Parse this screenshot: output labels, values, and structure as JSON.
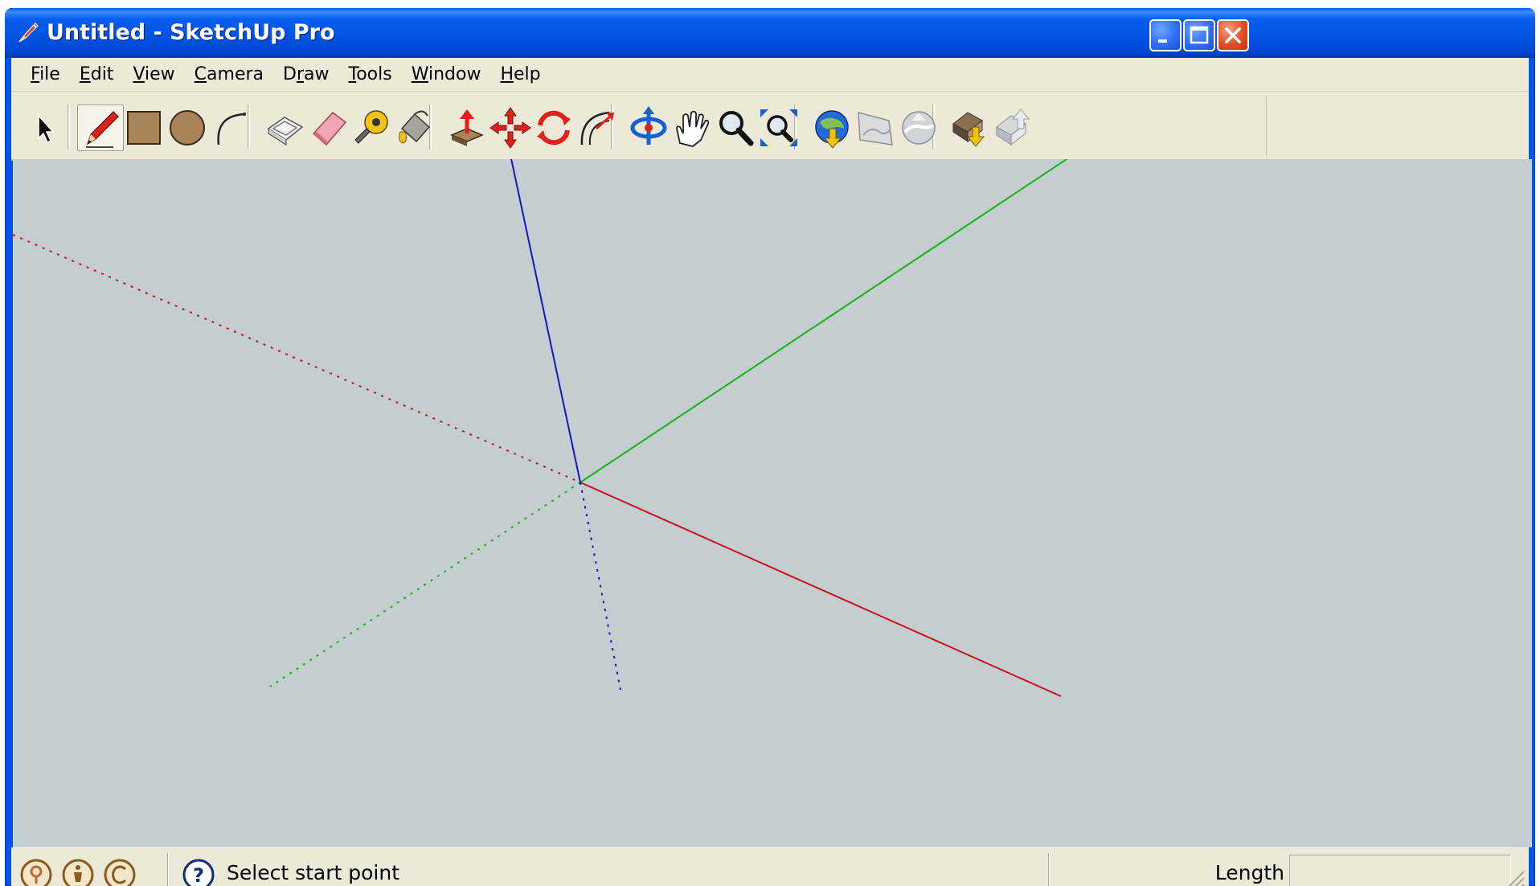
{
  "window": {
    "title": "Untitled - SketchUp Pro",
    "minimize_label": "Minimize",
    "maximize_label": "Maximize",
    "close_label": "Close"
  },
  "menu": [
    {
      "label": "File",
      "mnemonic": "F",
      "rest": "ile"
    },
    {
      "label": "Edit",
      "mnemonic": "E",
      "rest": "dit"
    },
    {
      "label": "View",
      "mnemonic": "V",
      "rest": "iew"
    },
    {
      "label": "Camera",
      "mnemonic": "C",
      "rest": "amera"
    },
    {
      "label": "Draw",
      "pre": "D",
      "mnemonic": "r",
      "rest": "aw"
    },
    {
      "label": "Tools",
      "mnemonic": "T",
      "rest": "ools"
    },
    {
      "label": "Window",
      "mnemonic": "W",
      "rest": "indow"
    },
    {
      "label": "Help",
      "mnemonic": "H",
      "rest": "elp"
    }
  ],
  "toolbar": {
    "tools": [
      {
        "name": "select",
        "icon": "arrow-cursor-icon"
      },
      {
        "name": "line",
        "icon": "pencil-icon",
        "active": true
      },
      {
        "name": "rectangle",
        "icon": "rectangle-icon"
      },
      {
        "name": "circle",
        "icon": "circle-icon"
      },
      {
        "name": "arc",
        "icon": "arc-icon"
      },
      {
        "name": "make-component",
        "icon": "component-box-icon"
      },
      {
        "name": "eraser",
        "icon": "eraser-icon"
      },
      {
        "name": "tape-measure",
        "icon": "tape-measure-icon"
      },
      {
        "name": "paint-bucket",
        "icon": "paint-bucket-icon"
      },
      {
        "name": "push-pull",
        "icon": "push-pull-icon"
      },
      {
        "name": "move",
        "icon": "move-arrows-icon"
      },
      {
        "name": "rotate",
        "icon": "rotate-icon"
      },
      {
        "name": "offset",
        "icon": "offset-icon"
      },
      {
        "name": "orbit",
        "icon": "orbit-icon"
      },
      {
        "name": "pan",
        "icon": "hand-icon"
      },
      {
        "name": "zoom",
        "icon": "magnifier-icon"
      },
      {
        "name": "zoom-extents",
        "icon": "zoom-extents-icon"
      },
      {
        "name": "get-current-view",
        "icon": "globe-download-icon"
      },
      {
        "name": "toggle-terrain",
        "icon": "terrain-icon"
      },
      {
        "name": "place-model",
        "icon": "globe-upload-icon"
      },
      {
        "name": "get-models",
        "icon": "house-download-icon"
      },
      {
        "name": "share-model",
        "icon": "house-upload-icon"
      }
    ]
  },
  "colors": {
    "viewport_bg": "#c4cdd0",
    "axis_red": "#c8141e",
    "axis_green": "#14b414",
    "axis_blue": "#1414c8"
  },
  "status": {
    "hint": "Select start point",
    "vcb_label": "Length",
    "vcb_value": "",
    "icons": [
      "geo-location-icon",
      "credits-icon",
      "copyright-icon",
      "help-icon"
    ]
  }
}
